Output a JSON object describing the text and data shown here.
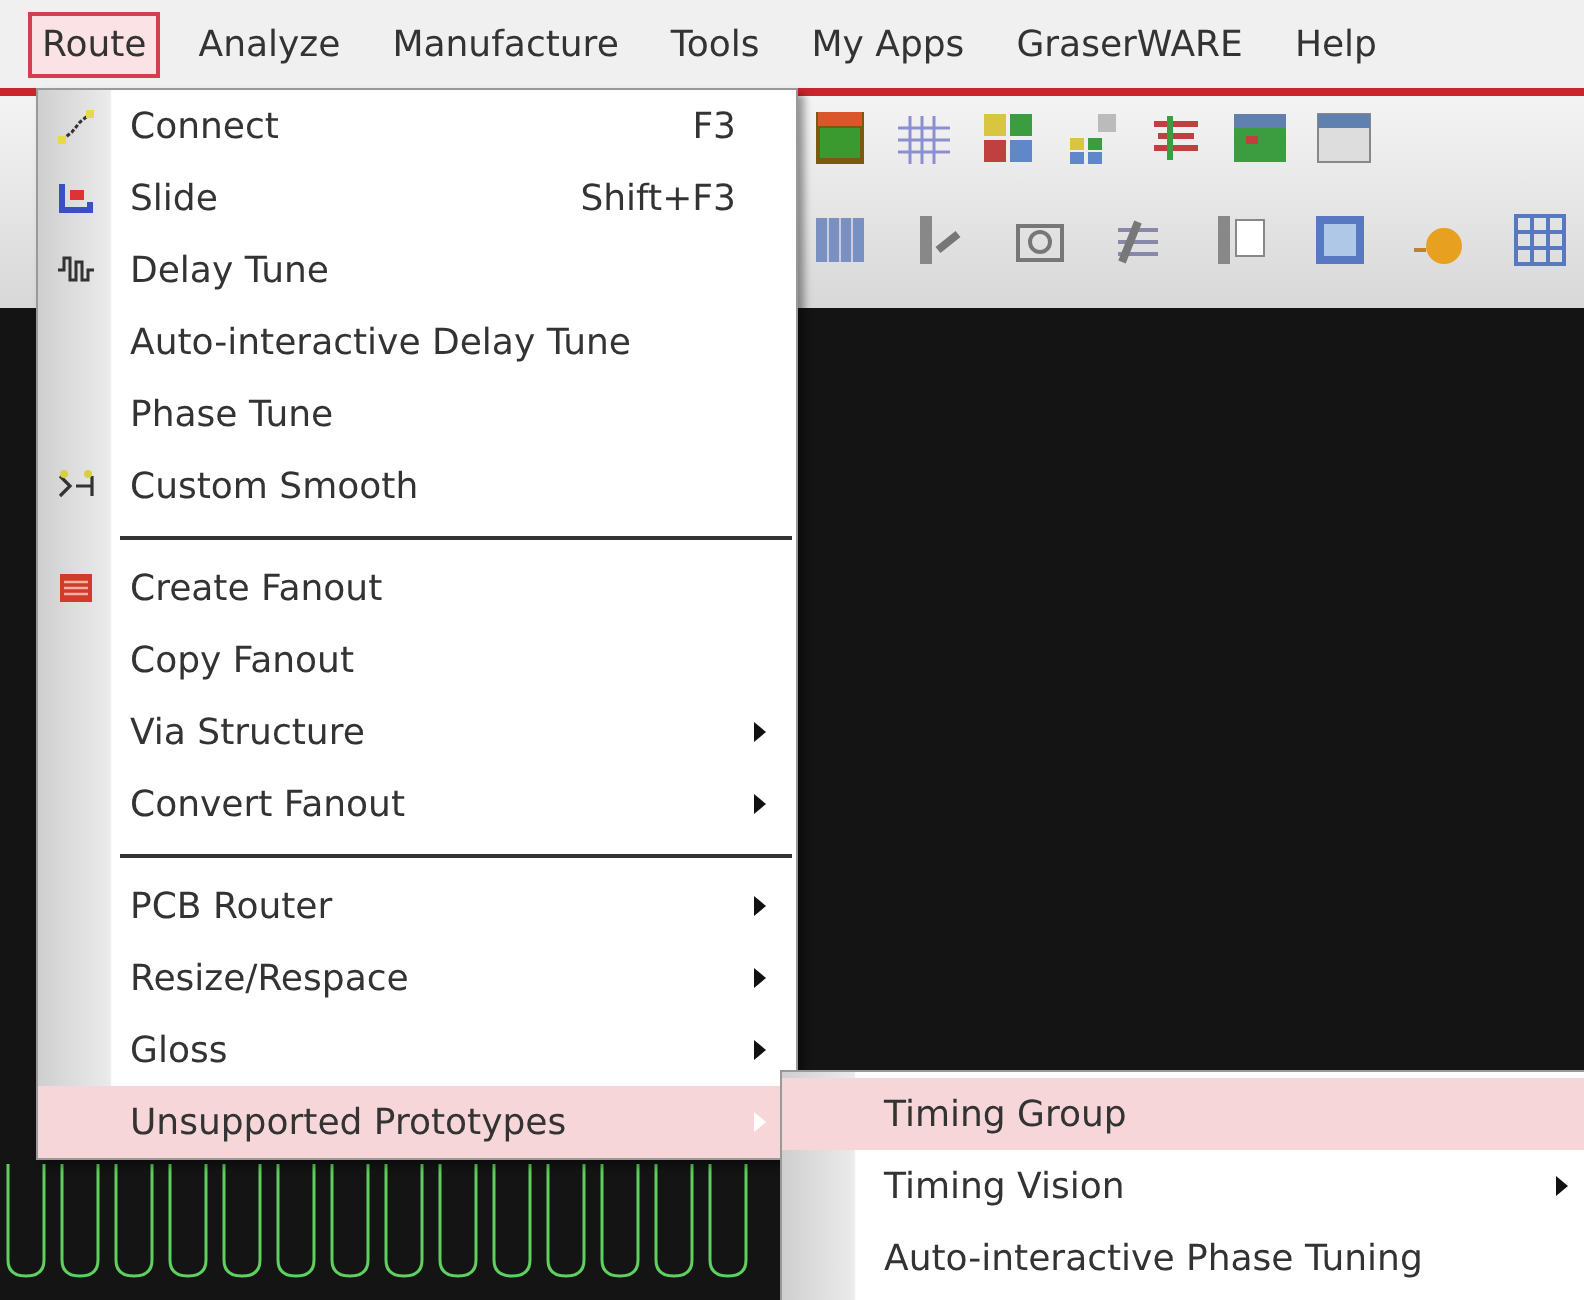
{
  "menubar": [
    {
      "label": "Route",
      "selected": true
    },
    {
      "label": "Analyze",
      "selected": false
    },
    {
      "label": "Manufacture",
      "selected": false
    },
    {
      "label": "Tools",
      "selected": false
    },
    {
      "label": "My Apps",
      "selected": false
    },
    {
      "label": "GraserWARE",
      "selected": false
    },
    {
      "label": "Help",
      "selected": false
    }
  ],
  "route_menu": [
    {
      "kind": "item",
      "label": "Connect",
      "shortcut": "F3",
      "submenu": false,
      "selected": false
    },
    {
      "kind": "item",
      "label": "Slide",
      "shortcut": "Shift+F3",
      "submenu": false,
      "selected": false
    },
    {
      "kind": "item",
      "label": "Delay Tune",
      "submenu": false,
      "selected": false
    },
    {
      "kind": "item",
      "label": "Auto-interactive Delay Tune",
      "submenu": false,
      "selected": false
    },
    {
      "kind": "item",
      "label": "Phase Tune",
      "submenu": false,
      "selected": false
    },
    {
      "kind": "item",
      "label": "Custom Smooth",
      "submenu": false,
      "selected": false
    },
    {
      "kind": "separator"
    },
    {
      "kind": "item",
      "label": "Create Fanout",
      "submenu": false,
      "selected": false
    },
    {
      "kind": "item",
      "label": "Copy Fanout",
      "submenu": false,
      "selected": false
    },
    {
      "kind": "item",
      "label": "Via Structure",
      "submenu": true,
      "selected": false
    },
    {
      "kind": "item",
      "label": "Convert Fanout",
      "submenu": true,
      "selected": false
    },
    {
      "kind": "separator"
    },
    {
      "kind": "item",
      "label": "PCB Router",
      "submenu": true,
      "selected": false
    },
    {
      "kind": "item",
      "label": "Resize/Respace",
      "submenu": true,
      "selected": false
    },
    {
      "kind": "item",
      "label": "Gloss",
      "submenu": true,
      "selected": false
    },
    {
      "kind": "item",
      "label": "Unsupported Prototypes",
      "submenu": true,
      "selected": true
    }
  ],
  "prototypes_submenu": [
    {
      "kind": "item",
      "label": "Timing Group",
      "submenu": false,
      "selected": true
    },
    {
      "kind": "item",
      "label": "Timing Vision",
      "submenu": true,
      "selected": false
    },
    {
      "kind": "item",
      "label": "Auto-interactive Phase Tuning",
      "submenu": false,
      "selected": false
    }
  ]
}
